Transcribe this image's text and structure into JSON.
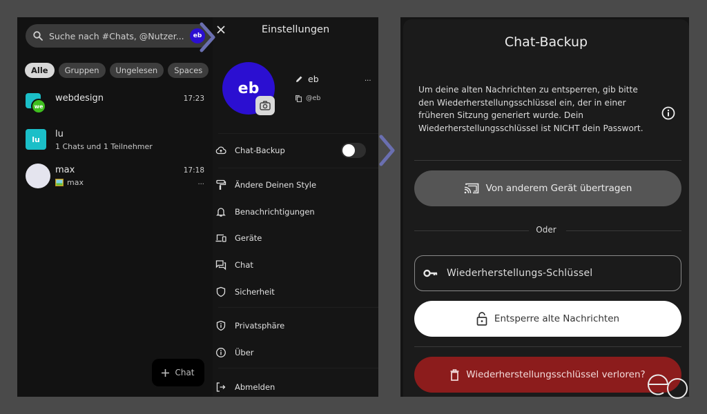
{
  "chat_list": {
    "search": {
      "placeholder": "Suche nach #Chats, @Nutzer...",
      "avatar_initials": "eb"
    },
    "filters": [
      {
        "label": "Alle",
        "active": true
      },
      {
        "label": "Gruppen",
        "active": false
      },
      {
        "label": "Ungelesen",
        "active": false
      },
      {
        "label": "Spaces",
        "active": false
      }
    ],
    "chats": [
      {
        "name": "webdesign",
        "time": "17:23",
        "subtitle": "",
        "avatar_initials": "we",
        "avatar_color": "#3fbf1f",
        "avatar_back_color": "#1bbfc8"
      },
      {
        "name": "lu",
        "time": "",
        "subtitle": "1 Chats und 1 Teilnehmer",
        "avatar_initials": "lu",
        "avatar_color": "#1bbfc8"
      },
      {
        "name": "max",
        "time": "17:18",
        "subtitle": "max",
        "subtitle_icon": "image-icon",
        "more": "...",
        "avatar_color": "#e4e4ee"
      }
    ],
    "new_chat_button": "Chat"
  },
  "settings": {
    "title": "Einstellungen",
    "profile": {
      "avatar_initials": "eb",
      "display_name": "eb",
      "user_id": "@eb",
      "more": "..."
    },
    "items": [
      {
        "label": "Chat-Backup",
        "icon": "cloud-upload-icon",
        "toggle": false
      },
      {
        "label": "Ändere Deinen Style",
        "icon": "paint-roller-icon"
      },
      {
        "label": "Benachrichtigungen",
        "icon": "bell-icon"
      },
      {
        "label": "Geräte",
        "icon": "devices-icon"
      },
      {
        "label": "Chat",
        "icon": "chat-bubbles-icon"
      },
      {
        "label": "Sicherheit",
        "icon": "shield-icon"
      },
      {
        "label": "Privatsphäre",
        "icon": "privacy-shield-icon"
      },
      {
        "label": "Über",
        "icon": "info-icon"
      },
      {
        "label": "Abmelden",
        "icon": "logout-icon"
      }
    ]
  },
  "backup": {
    "title": "Chat-Backup",
    "description": "Um deine alten Nachrichten zu entsperren, gib bitte den Wiederherstellungsschlüssel ein, der in einer früheren Sitzung generiert wurde. Dein Wiederherstellungsschlüssel ist NICHT dein Passwort.",
    "transfer_button": "Von anderem Gerät übertragen",
    "or_label": "Oder",
    "recovery_key_placeholder": "Wiederherstellungs-Schlüssel",
    "unlock_button": "Entsperre alte Nachrichten",
    "lost_key_button": "Wiederherstellungsschlüssel verloren?"
  },
  "colors": {
    "accent_avatar": "#2b0fd1",
    "arrow": "#6a6fb0",
    "danger": "#8c1c1c"
  }
}
